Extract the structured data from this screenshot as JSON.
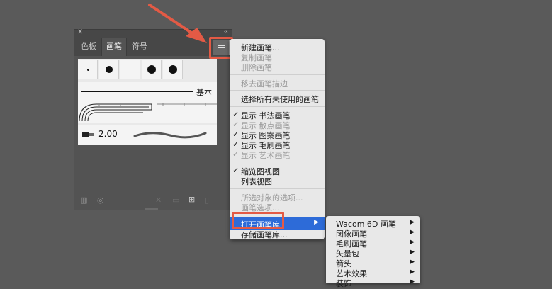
{
  "panel": {
    "tabs": [
      {
        "label": "色板"
      },
      {
        "label": "画笔"
      },
      {
        "label": "符号"
      }
    ],
    "basic_brush_label": "基本",
    "bristle_value": "2.00"
  },
  "menu": {
    "items": [
      {
        "label": "新建画笔...",
        "enabled": true
      },
      {
        "label": "复制画笔",
        "enabled": false
      },
      {
        "label": "删除画笔",
        "enabled": false
      },
      {
        "label": "移去画笔描边",
        "enabled": false
      },
      {
        "label": "选择所有未使用的画笔",
        "enabled": true
      },
      {
        "label": "显示 书法画笔",
        "enabled": true,
        "checked": true
      },
      {
        "label": "显示 散点画笔",
        "enabled": false,
        "checked": true
      },
      {
        "label": "显示 图案画笔",
        "enabled": true,
        "checked": true
      },
      {
        "label": "显示 毛刷画笔",
        "enabled": true,
        "checked": true
      },
      {
        "label": "显示 艺术画笔",
        "enabled": false,
        "checked": true
      },
      {
        "label": "缩览图视图",
        "enabled": true,
        "checked": true
      },
      {
        "label": "列表视图",
        "enabled": true
      },
      {
        "label": "所选对象的选项...",
        "enabled": false
      },
      {
        "label": "画笔选项...",
        "enabled": false
      },
      {
        "label": "打开画笔库",
        "enabled": true,
        "selected": true
      },
      {
        "label": "存储画笔库...",
        "enabled": true
      }
    ]
  },
  "submenu": {
    "items": [
      {
        "label": "Wacom 6D 画笔"
      },
      {
        "label": "图像画笔"
      },
      {
        "label": "毛刷画笔"
      },
      {
        "label": "矢量包"
      },
      {
        "label": "箭头"
      },
      {
        "label": "艺术效果"
      },
      {
        "label": "装饰"
      }
    ]
  },
  "colors": {
    "selection": "#2d6bd8",
    "annotation": "#e35a45"
  }
}
